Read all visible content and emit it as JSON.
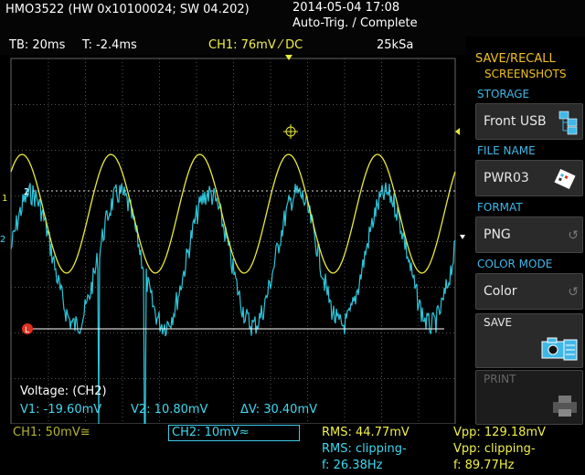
{
  "header": {
    "model": "HMO3522 (HW 0x10100024; SW 04.202)",
    "datetime": "2014-05-04 17:08",
    "status": "Auto-Trig. / Complete"
  },
  "infobar": {
    "timebase": "TB: 20ms",
    "trigger_time": "T: -2.4ms",
    "ch1": "CH1: 76mV ⁄ DC",
    "sample_rate": "25kSa"
  },
  "markers": {
    "ch1_marker": "1",
    "ch2_marker": "2",
    "ref_marker": "2",
    "cursor_marker": "L"
  },
  "cursor_readout": {
    "title": "Voltage: (CH2)",
    "v1": "V1: -19.60mV",
    "v2": "V2: 10.80mV",
    "dv": "ΔV: 30.40mV"
  },
  "menu": {
    "title": "SAVE/RECALL",
    "subtitle": "SCREENSHOTS",
    "storage_label": "STORAGE",
    "storage_value": "Front USB",
    "filename_label": "FILE NAME",
    "filename_value": "PWR03",
    "format_label": "FORMAT",
    "format_value": "PNG",
    "colormode_label": "COLOR MODE",
    "colormode_value": "Color",
    "save_label": "SAVE",
    "print_label": "PRINT"
  },
  "bottom": {
    "ch1": "CH1: 50mV≅",
    "ch2": "CH2: 10mV≈",
    "rms1": "RMS: 44.77mV",
    "rms2": "RMS: clipping-",
    "freq2": "f: 26.38Hz",
    "vpp1": "Vpp: 129.18mV",
    "vpp2": "Vpp: clipping-",
    "freq3": "f: 89.77Hz"
  },
  "colors": {
    "ch1": "#f0f04a",
    "ch2": "#3fd8f0",
    "menu_header": "#f0c020",
    "menu_label": "#3fb8e8"
  },
  "waveforms": {
    "ch1_sine": {
      "cycles": 5.0,
      "amplitude_div": 1.3,
      "offset_div": -0.6
    },
    "ch2_noisy": {
      "cycles": 5.0,
      "amplitude_div": 1.6,
      "offset_div": 0.0
    }
  }
}
